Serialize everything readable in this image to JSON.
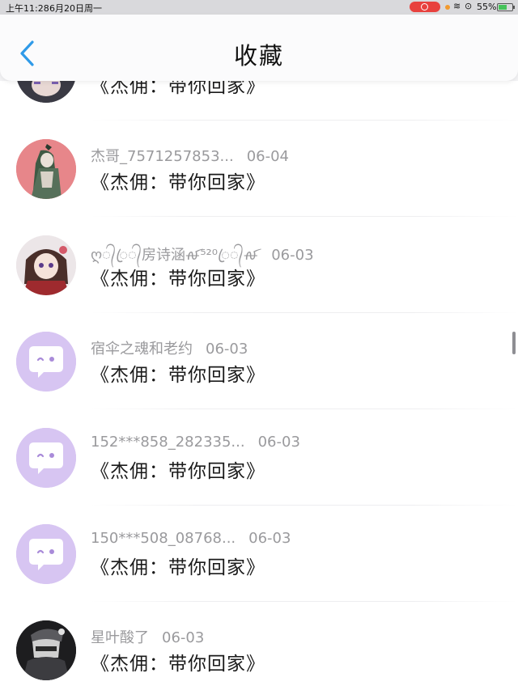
{
  "status_bar": {
    "time": "上午11:28",
    "date": "6月20日周一",
    "battery": "55%",
    "battery_level": 0.55,
    "recording_color": "#e8413e"
  },
  "nav": {
    "back_icon": "chevron-left-icon",
    "title": "收藏",
    "accent_color": "#2f9ae8"
  },
  "items": [
    {
      "name": "",
      "date": "",
      "message": "《杰佣：带你回家》",
      "avatar": "user-avatar"
    },
    {
      "name": "杰哥_7571257853...",
      "date": "06-04",
      "message": "《杰佣：带你回家》",
      "avatar": "user-avatar"
    },
    {
      "name": "ღ᭄ꦿ᭄房诗涵ꫛ⁵²⁰ꦿ᭄ꫛ",
      "date": "06-03",
      "message": "《杰佣：带你回家》",
      "avatar": "user-avatar"
    },
    {
      "name": "宿伞之魂和老约",
      "date": "06-03",
      "message": "《杰佣：带你回家》",
      "avatar": "default-chat-bubble-avatar"
    },
    {
      "name": "152***858_282335...",
      "date": "06-03",
      "message": "《杰佣：带你回家》",
      "avatar": "default-chat-bubble-avatar"
    },
    {
      "name": "150***508_08768...",
      "date": "06-03",
      "message": "《杰佣：带你回家》",
      "avatar": "default-chat-bubble-avatar"
    },
    {
      "name": "星叶酸了",
      "date": "06-03",
      "message": "《杰佣：带你回家》",
      "avatar": "user-avatar"
    }
  ]
}
